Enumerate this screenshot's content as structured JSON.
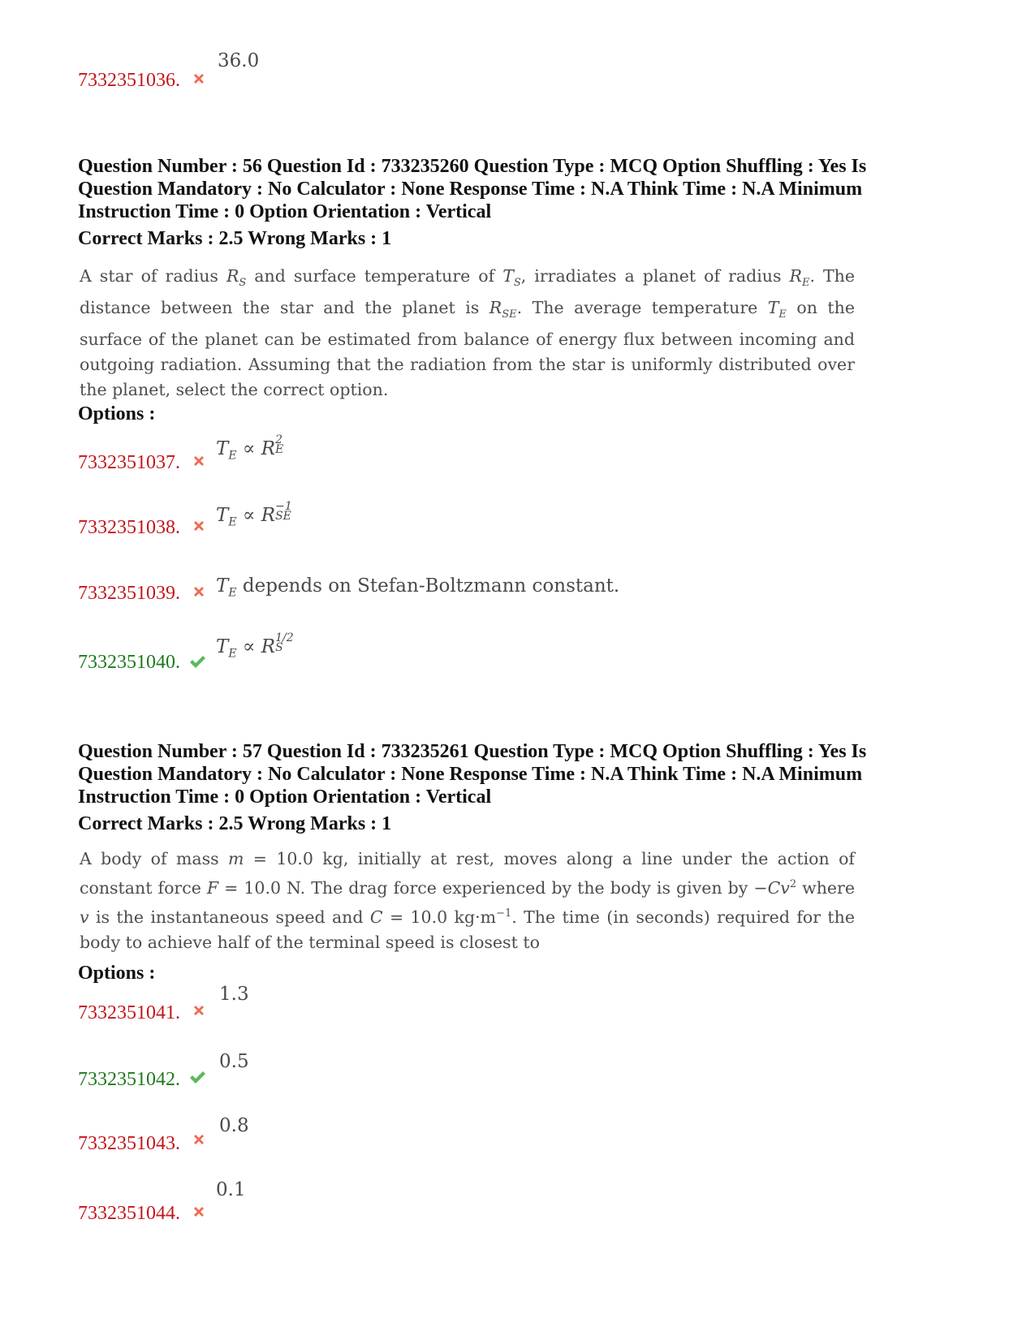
{
  "colors": {
    "wrong_id": "#c4161c",
    "correct_id": "#1e7a1e",
    "wrong_icon": "#ee6a50",
    "correct_icon": "#5cb85c",
    "header_text": "#111111",
    "body_text": "#4d4d4d"
  },
  "prev_option": {
    "id": "7332351036.",
    "status": "wrong",
    "icon": "cross-icon",
    "content": "36.0"
  },
  "questions": [
    {
      "header": "Question Number : 56 Question Id : 733235260 Question Type : MCQ Option Shuffling : Yes Is Question Mandatory : No Calculator : None Response Time : N.A Think Time : N.A Minimum Instruction Time : 0 Option Orientation : Vertical",
      "marks": "Correct Marks : 2.5 Wrong Marks : 1",
      "text_parts": {
        "p1": "A star of radius ",
        "p2": " and surface temperature of ",
        "p3": ", irradiates a planet of radius ",
        "p4": ". The distance between the star and the planet is ",
        "p5": ". The average temperature ",
        "p6": " on the surface of the planet can be estimated from balance of energy flux between incoming and outgoing radiation. Assuming that the radiation from the star is uniformly distributed over the planet, select the correct option."
      },
      "text": "A star of radius R_S and surface temperature of T_S, irradiates a planet of radius R_E. The distance between the star and the planet is R_SE. The average temperature T_E on the surface of the planet can be estimated from balance of energy flux between incoming and outgoing radiation. Assuming that the radiation from the star is uniformly distributed over the planet, select the correct option.",
      "options_label": "Options :",
      "options": [
        {
          "id": "7332351037.",
          "status": "wrong",
          "icon": "cross-icon",
          "content": "T_E ∝ R_E^2"
        },
        {
          "id": "7332351038.",
          "status": "wrong",
          "icon": "cross-icon",
          "content": "T_E ∝ R_SE^-1"
        },
        {
          "id": "7332351039.",
          "status": "wrong",
          "icon": "cross-icon",
          "content": "T_E depends on Stefan-Boltzmann constant."
        },
        {
          "id": "7332351040.",
          "status": "correct",
          "icon": "check-icon",
          "content": "T_E ∝ R_S^1/2"
        }
      ]
    },
    {
      "header": "Question Number : 57 Question Id : 733235261 Question Type : MCQ Option Shuffling : Yes Is Question Mandatory : No Calculator : None Response Time : N.A Think Time : N.A Minimum Instruction Time : 0 Option Orientation : Vertical",
      "marks": "Correct Marks : 2.5 Wrong Marks : 1",
      "text_parts": {
        "p1": "A body of mass ",
        "p2": " = 10.0 kg, initially at rest, moves along a line under the action of constant force ",
        "p3": " = 10.0 N. The drag force experienced by the body is given by −",
        "p4": " where ",
        "p5": " is the instantaneous speed and ",
        "p6": " = 10.0 kg·m",
        "p7": ". The time (in seconds) required for the body to achieve half of the terminal speed is closest to"
      },
      "text": "A body of mass m = 10.0 kg, initially at rest, moves along a line under the action of constant force F = 10.0 N. The drag force experienced by the body is given by −Cv^2 where v is the instantaneous speed and C = 10.0 kg·m^-1. The time (in seconds) required for the body to achieve half of the terminal speed is closest to",
      "options_label": "Options :",
      "options": [
        {
          "id": "7332351041.",
          "status": "wrong",
          "icon": "cross-icon",
          "content": "1.3"
        },
        {
          "id": "7332351042.",
          "status": "correct",
          "icon": "check-icon",
          "content": "0.5"
        },
        {
          "id": "7332351043.",
          "status": "wrong",
          "icon": "cross-icon",
          "content": "0.8"
        },
        {
          "id": "7332351044.",
          "status": "wrong",
          "icon": "cross-icon",
          "content": "0.1"
        }
      ]
    }
  ]
}
